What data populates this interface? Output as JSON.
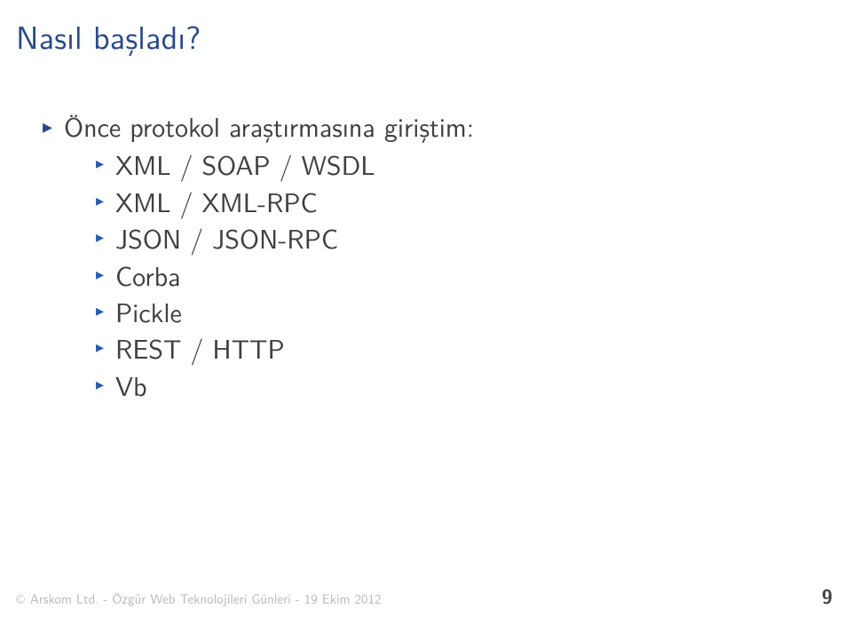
{
  "title": "Nasıl başladı?",
  "main_bullet": "Önce protokol araştırmasına giriştim:",
  "sub_bullets": [
    "XML / SOAP / WSDL",
    "XML / XML-RPC",
    "JSON / JSON-RPC",
    "Corba",
    "Pickle",
    "REST / HTTP",
    "Vb"
  ],
  "footer": {
    "copyright": "©",
    "text": "Arskom Ltd. - Özgür Web Teknolojileri Günleri - 19 Ekim 2012",
    "page": "9"
  }
}
